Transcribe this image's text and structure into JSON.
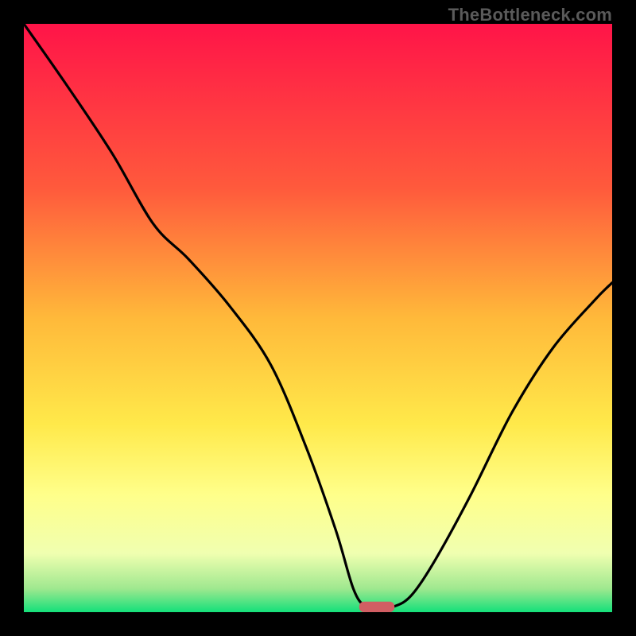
{
  "watermark": "TheBottleneck.com",
  "chart_data": {
    "type": "line",
    "title": "",
    "xlabel": "",
    "ylabel": "",
    "xlim": [
      0,
      100
    ],
    "ylim": [
      0,
      100
    ],
    "grid": false,
    "legend": false,
    "gradient_stops": [
      {
        "pct": 0,
        "color": "#ff1448"
      },
      {
        "pct": 28,
        "color": "#ff5a3c"
      },
      {
        "pct": 50,
        "color": "#ffb93a"
      },
      {
        "pct": 68,
        "color": "#ffe94a"
      },
      {
        "pct": 80,
        "color": "#ffff8a"
      },
      {
        "pct": 90,
        "color": "#f0ffb0"
      },
      {
        "pct": 96,
        "color": "#9fe88f"
      },
      {
        "pct": 100,
        "color": "#14e07a"
      }
    ],
    "series": [
      {
        "name": "bottleneck-curve",
        "stroke": "#000000",
        "x": [
          0,
          7,
          15,
          22,
          28,
          35,
          42,
          48,
          53,
          56,
          58,
          60,
          63,
          66,
          70,
          76,
          83,
          90,
          97,
          100
        ],
        "y": [
          100,
          90,
          78,
          66,
          60,
          52,
          42,
          28,
          14,
          4,
          1,
          1,
          1,
          3,
          9,
          20,
          34,
          45,
          53,
          56
        ]
      }
    ],
    "marker": {
      "name": "optimal-marker",
      "x": 60,
      "y": 0,
      "width_pct": 6,
      "height_pct": 1.8,
      "color": "#d15e63"
    }
  }
}
